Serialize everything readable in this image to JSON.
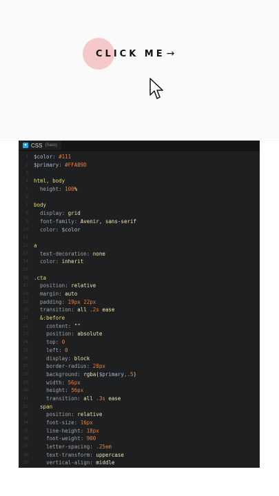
{
  "preview": {
    "cta_label": "Click me",
    "cta_arrow": "→",
    "colors": {
      "circle": "#f5c9c8",
      "text": "#111111",
      "background": "#fafafa"
    }
  },
  "editor": {
    "tab_title": "CSS",
    "tab_subtitle": "(Sass)",
    "tab_icon_glyph": "▾",
    "code": [
      [
        [
          "var",
          "$color"
        ],
        [
          "pun",
          ": "
        ],
        [
          "num",
          "#111"
        ]
      ],
      [
        [
          "var",
          "$primary"
        ],
        [
          "pun",
          ": "
        ],
        [
          "num",
          "#FFAB9D"
        ]
      ],
      [],
      [
        [
          "sel",
          "html, body"
        ]
      ],
      [
        [
          "pun",
          "  "
        ],
        [
          "prop",
          "height"
        ],
        [
          "pun",
          ": "
        ],
        [
          "num",
          "100"
        ],
        [
          "val",
          "%"
        ]
      ],
      [],
      [
        [
          "sel",
          "body"
        ]
      ],
      [
        [
          "pun",
          "  "
        ],
        [
          "prop",
          "display"
        ],
        [
          "pun",
          ": "
        ],
        [
          "val",
          "grid"
        ]
      ],
      [
        [
          "pun",
          "  "
        ],
        [
          "prop",
          "font-family"
        ],
        [
          "pun",
          ": "
        ],
        [
          "val",
          "Avenir, sans-serif"
        ]
      ],
      [
        [
          "pun",
          "  "
        ],
        [
          "prop",
          "color"
        ],
        [
          "pun",
          ": "
        ],
        [
          "var",
          "$color"
        ]
      ],
      [],
      [
        [
          "sel",
          "a"
        ]
      ],
      [
        [
          "pun",
          "  "
        ],
        [
          "prop",
          "text-decoration"
        ],
        [
          "pun",
          ": "
        ],
        [
          "val",
          "none"
        ]
      ],
      [
        [
          "pun",
          "  "
        ],
        [
          "prop",
          "color"
        ],
        [
          "pun",
          ": "
        ],
        [
          "val",
          "inherit"
        ]
      ],
      [],
      [
        [
          "sel",
          ".cta"
        ]
      ],
      [
        [
          "pun",
          "  "
        ],
        [
          "prop",
          "position"
        ],
        [
          "pun",
          ": "
        ],
        [
          "val",
          "relative"
        ]
      ],
      [
        [
          "pun",
          "  "
        ],
        [
          "prop",
          "margin"
        ],
        [
          "pun",
          ": "
        ],
        [
          "val",
          "auto"
        ]
      ],
      [
        [
          "pun",
          "  "
        ],
        [
          "prop",
          "padding"
        ],
        [
          "pun",
          ": "
        ],
        [
          "num",
          "19px 22px"
        ]
      ],
      [
        [
          "pun",
          "  "
        ],
        [
          "prop",
          "transition"
        ],
        [
          "pun",
          ": "
        ],
        [
          "val",
          "all "
        ],
        [
          "num",
          ".2s"
        ],
        [
          "val",
          " ease"
        ]
      ],
      [
        [
          "pun",
          "  "
        ],
        [
          "sel",
          "&:before"
        ]
      ],
      [
        [
          "pun",
          "    "
        ],
        [
          "prop",
          "content"
        ],
        [
          "pun",
          ": "
        ],
        [
          "val",
          "\"\""
        ]
      ],
      [
        [
          "pun",
          "    "
        ],
        [
          "prop",
          "position"
        ],
        [
          "pun",
          ": "
        ],
        [
          "val",
          "absolute"
        ]
      ],
      [
        [
          "pun",
          "    "
        ],
        [
          "prop",
          "top"
        ],
        [
          "pun",
          ": "
        ],
        [
          "num",
          "0"
        ]
      ],
      [
        [
          "pun",
          "    "
        ],
        [
          "prop",
          "left"
        ],
        [
          "pun",
          ": "
        ],
        [
          "num",
          "0"
        ]
      ],
      [
        [
          "pun",
          "    "
        ],
        [
          "prop",
          "display"
        ],
        [
          "pun",
          ": "
        ],
        [
          "val",
          "block"
        ]
      ],
      [
        [
          "pun",
          "    "
        ],
        [
          "prop",
          "border-radius"
        ],
        [
          "pun",
          ": "
        ],
        [
          "num",
          "28px"
        ]
      ],
      [
        [
          "pun",
          "    "
        ],
        [
          "prop",
          "background"
        ],
        [
          "pun",
          ": "
        ],
        [
          "val",
          "rgba("
        ],
        [
          "var",
          "$primary"
        ],
        [
          "pun",
          ","
        ],
        [
          "num",
          ".5"
        ],
        [
          "val",
          ")"
        ]
      ],
      [
        [
          "pun",
          "    "
        ],
        [
          "prop",
          "width"
        ],
        [
          "pun",
          ": "
        ],
        [
          "num",
          "56px"
        ]
      ],
      [
        [
          "pun",
          "    "
        ],
        [
          "prop",
          "height"
        ],
        [
          "pun",
          ": "
        ],
        [
          "num",
          "56px"
        ]
      ],
      [
        [
          "pun",
          "    "
        ],
        [
          "prop",
          "transition"
        ],
        [
          "pun",
          ": "
        ],
        [
          "val",
          "all "
        ],
        [
          "num",
          ".3s"
        ],
        [
          "val",
          " ease"
        ]
      ],
      [
        [
          "pun",
          "  "
        ],
        [
          "sel",
          "span"
        ]
      ],
      [
        [
          "pun",
          "    "
        ],
        [
          "prop",
          "position"
        ],
        [
          "pun",
          ": "
        ],
        [
          "val",
          "relative"
        ]
      ],
      [
        [
          "pun",
          "    "
        ],
        [
          "prop",
          "font-size"
        ],
        [
          "pun",
          ": "
        ],
        [
          "num",
          "16px"
        ]
      ],
      [
        [
          "pun",
          "    "
        ],
        [
          "prop",
          "line-height"
        ],
        [
          "pun",
          ": "
        ],
        [
          "num",
          "18px"
        ]
      ],
      [
        [
          "pun",
          "    "
        ],
        [
          "prop",
          "font-weight"
        ],
        [
          "pun",
          ": "
        ],
        [
          "num",
          "900"
        ]
      ],
      [
        [
          "pun",
          "    "
        ],
        [
          "prop",
          "letter-spacing"
        ],
        [
          "pun",
          ": "
        ],
        [
          "num",
          ".25em"
        ]
      ],
      [
        [
          "pun",
          "    "
        ],
        [
          "prop",
          "text-transform"
        ],
        [
          "pun",
          ": "
        ],
        [
          "val",
          "uppercase"
        ]
      ],
      [
        [
          "pun",
          "    "
        ],
        [
          "prop",
          "vertical-align"
        ],
        [
          "pun",
          ": "
        ],
        [
          "val",
          "middle"
        ]
      ]
    ]
  }
}
